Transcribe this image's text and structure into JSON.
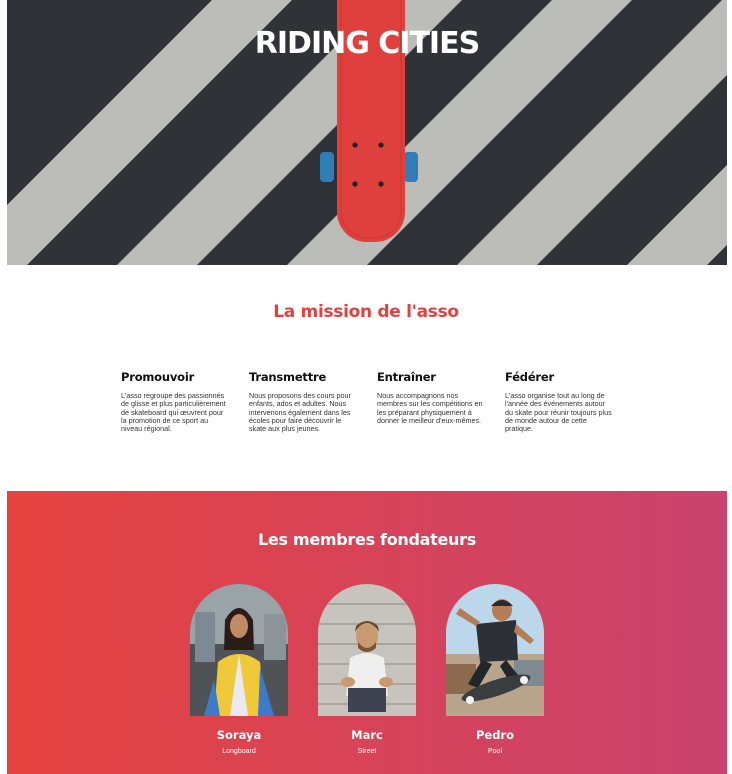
{
  "hero": {
    "title": "RIDING CITIES"
  },
  "mission": {
    "title": "La mission de l'asso",
    "pillars": [
      {
        "title": "Promouvoir",
        "text": "L'asso regroupe des passionnés de glisse et plus particulièrement de skateboard qui œuvrent pour la promotion de ce sport au niveau régional."
      },
      {
        "title": "Transmettre",
        "text": "Nous proposons des cours pour enfants, ados et adultes. Nous intervenons également dans les écoles pour faire découvrir le skate aux plus jeunes."
      },
      {
        "title": "Entraîner",
        "text": "Nous accompagnons nos membres sur les compétitions en les préparant physiquement à donner le meilleur d'eux-mêmes."
      },
      {
        "title": "Fédérer",
        "text": "L'asso organise tout au long de l'année des événements autour du skate pour réunir toujours plus de monde autour de cette pratique."
      }
    ]
  },
  "founders": {
    "title": "Les membres fondateurs",
    "members": [
      {
        "name": "Soraya",
        "role": "Longboard"
      },
      {
        "name": "Marc",
        "role": "Street"
      },
      {
        "name": "Pedro",
        "role": "Pool"
      }
    ]
  },
  "colors": {
    "accent": "#e3413f",
    "gradient_start": "#e5433f",
    "gradient_end": "#c9436f",
    "skateboard": "#e0403d",
    "wheels": "#2f7fb6"
  }
}
